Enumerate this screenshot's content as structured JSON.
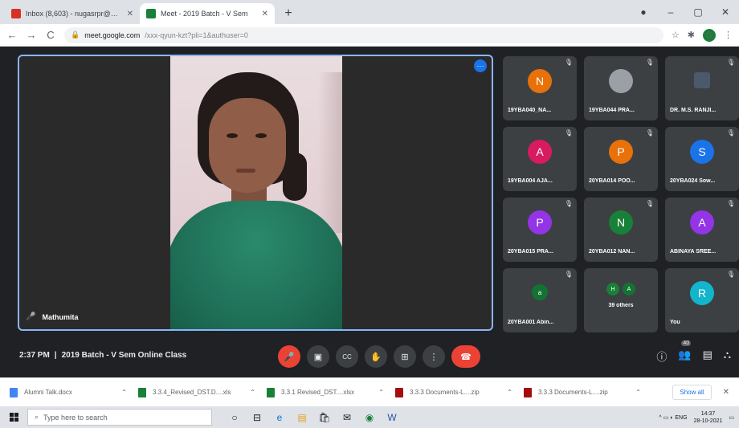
{
  "browser": {
    "tabs": [
      {
        "label": "Inbox (8,603) - nugasrpr@emsyj.c",
        "icon_color": "#d93025",
        "active": false
      },
      {
        "label": "Meet - 2019 Batch - V Sem",
        "icon_color": "#188038",
        "active": true
      }
    ],
    "new_tab": "+",
    "window_controls": {
      "menu": "●",
      "minimize": "–",
      "maximize": "▢",
      "close": "✕"
    },
    "nav": {
      "back": "←",
      "forward": "→",
      "reload": "C"
    },
    "url_host": "meet.google.com",
    "url_path": "/xxx-qyun-kzt?pli=1&authuser=0",
    "profile_initial": "G"
  },
  "meet": {
    "main_speaker": {
      "name": "Mathumita",
      "more_glyph": "⋯"
    },
    "tiles": [
      {
        "name": "19YBA040_NA...",
        "initial": "N",
        "color": "#e8710a"
      },
      {
        "name": "19YBA044 PRA...",
        "initial": "",
        "color": "#9aa0a6",
        "photo": true
      },
      {
        "name": "DR. M.S. RANJI...",
        "initial": "",
        "color": "#3c4043",
        "photo": true
      },
      {
        "name": "19YBA004 AJA...",
        "initial": "A",
        "color": "#d81b60"
      },
      {
        "name": "20YBA014 POO...",
        "initial": "P",
        "color": "#e8710a"
      },
      {
        "name": "20YBA024 Sow...",
        "initial": "S",
        "color": "#1a73e8"
      },
      {
        "name": "20YBA015 PRA...",
        "initial": "P",
        "color": "#9334e6"
      },
      {
        "name": "20YBA012 NAN...",
        "initial": "N",
        "color": "#188038"
      },
      {
        "name": "ABINAYA SREE...",
        "initial": "A",
        "color": "#9334e6"
      },
      {
        "name": "20YBA001 Abin...",
        "initial": "a",
        "color": "#137333"
      },
      {
        "name": "39 others",
        "initial": "",
        "color": "#3c4043",
        "pair": [
          "H",
          "A"
        ]
      },
      {
        "name": "You",
        "initial": "R",
        "color": "#12b5cb"
      }
    ],
    "time": "2:37 PM",
    "separator": "|",
    "meeting_title": "2019 Batch - V Sem Online Class",
    "controls": {
      "mic": "🎤",
      "camera": "▣",
      "captions": "CC",
      "raise_hand": "✋",
      "present": "⊞",
      "more": "⋮",
      "end_call": "☎"
    },
    "right_controls": {
      "info": "ⓘ",
      "people": "👥",
      "people_count": "40",
      "chat": "▤",
      "activities": "⛬"
    }
  },
  "downloads": {
    "items": [
      {
        "name": "Alumni Talk.docx",
        "color": "#4285f4"
      },
      {
        "name": "3.3.4_Revised_DST.D....xls",
        "color": "#188038"
      },
      {
        "name": "3.3.1 Revised_DST....xlsx",
        "color": "#188038"
      },
      {
        "name": "3.3.3 Documents-L....zip",
        "color": "#a50e0e"
      },
      {
        "name": "3.3.3 Documents-L....zip",
        "color": "#a50e0e"
      }
    ],
    "show_all": "Show all",
    "close": "✕"
  },
  "taskbar": {
    "search_placeholder": "Type here to search",
    "apps": [
      "○",
      "⊟",
      "e",
      "▤",
      "🛍",
      "✉",
      "◉",
      "W"
    ],
    "tray": {
      "icons": "^ ▭ ◐ ENG",
      "time": "14:37",
      "date": "28-10-2021"
    }
  }
}
